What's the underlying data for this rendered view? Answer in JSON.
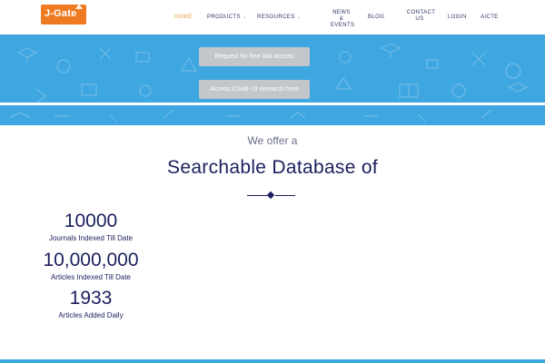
{
  "header": {
    "logo_text": "J-Gate",
    "nav": {
      "home": "HOME",
      "products": "PRODUCTS",
      "resources": "RESOURCES",
      "news_line1": "NEWS &",
      "news_line2": "EVENTS",
      "blog": "BLOG",
      "contact_line1": "CONTACT",
      "contact_line2": "US",
      "login": "LOGIN",
      "aicte": "AICTE"
    },
    "caret": "⌄"
  },
  "banner": {
    "trial_button": "Request for free trial access",
    "covid_button": "Access Covid-19 research here"
  },
  "main": {
    "offer": "We offer a",
    "headline": "Searchable Database of",
    "stats": [
      {
        "value": "10000",
        "label": "Journals Indexed Till Date"
      },
      {
        "value": "10,000,000",
        "label": "Articles Indexed Till Date"
      },
      {
        "value": "1933",
        "label": "Articles Added Daily"
      }
    ]
  },
  "colors": {
    "brand_orange": "#ee7b22",
    "banner_blue": "#3ea6e0",
    "navy": "#1b1f5e",
    "active_nav": "#e39b3c",
    "button_gray": "#c3c6cb"
  }
}
